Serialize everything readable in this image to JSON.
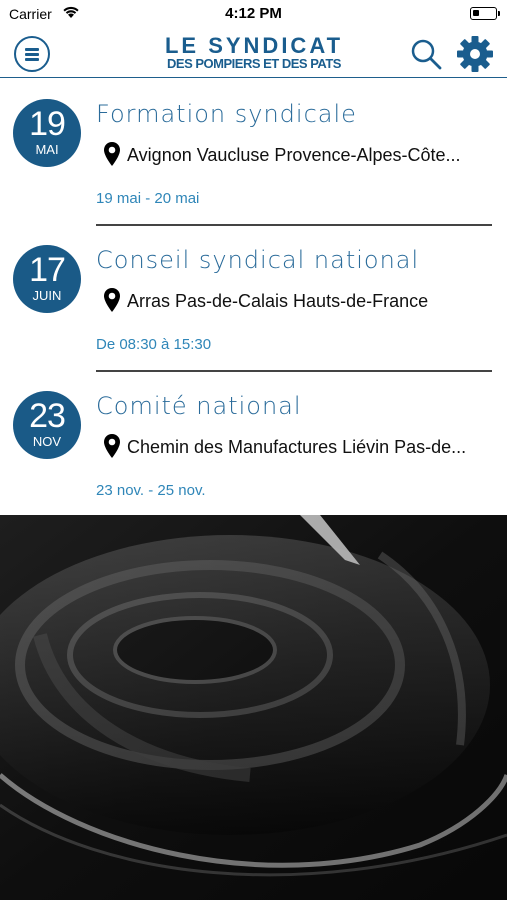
{
  "status_bar": {
    "carrier": "Carrier",
    "time": "4:12 PM"
  },
  "header": {
    "logo_line1": "LE SYNDICAT",
    "logo_line2": "DES POMPIERS ET DES PATS"
  },
  "events": [
    {
      "day": "19",
      "month": "MAI",
      "title": "Formation syndicale",
      "location": "Avignon Vaucluse Provence-Alpes-Côte...",
      "dates": "19 mai - 20 mai"
    },
    {
      "day": "17",
      "month": "JUIN",
      "title": "Conseil syndical national",
      "location": "Arras Pas-de-Calais Hauts-de-France",
      "dates": "De 08:30 à 15:30"
    },
    {
      "day": "23",
      "month": "NOV",
      "title": "Comité national",
      "location": "Chemin des Manufactures Liévin Pas-de...",
      "dates": "23 nov. - 25 nov."
    }
  ],
  "colors": {
    "primary": "#1a5a87",
    "title": "#2a6b9a",
    "date_text": "#2f86b8"
  },
  "icons": [
    "wifi-icon",
    "battery-icon",
    "menu-icon",
    "search-icon",
    "gear-icon",
    "location-pin-icon"
  ]
}
